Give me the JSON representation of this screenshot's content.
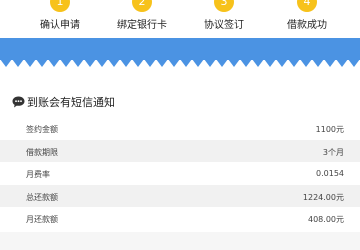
{
  "colors": {
    "step_circle": "#f7c21b",
    "band_blue": "#4b93e3",
    "row_alt": "#f1f1f1"
  },
  "steps": [
    {
      "number": "1",
      "label": "确认申请"
    },
    {
      "number": "2",
      "label": "绑定银行卡"
    },
    {
      "number": "3",
      "label": "协议签订"
    },
    {
      "number": "4",
      "label": "借款成功"
    }
  ],
  "notice": {
    "icon": "chat-bubble-icon",
    "title": "到账会有短信通知"
  },
  "details": [
    {
      "label": "签约金额",
      "value": "1100元"
    },
    {
      "label": "借款期限",
      "value": "3个月"
    },
    {
      "label": "月费率",
      "value": "0.0154"
    },
    {
      "label": "总还款额",
      "value": "1224.00元"
    },
    {
      "label": "月还款额",
      "value": "408.00元"
    }
  ]
}
